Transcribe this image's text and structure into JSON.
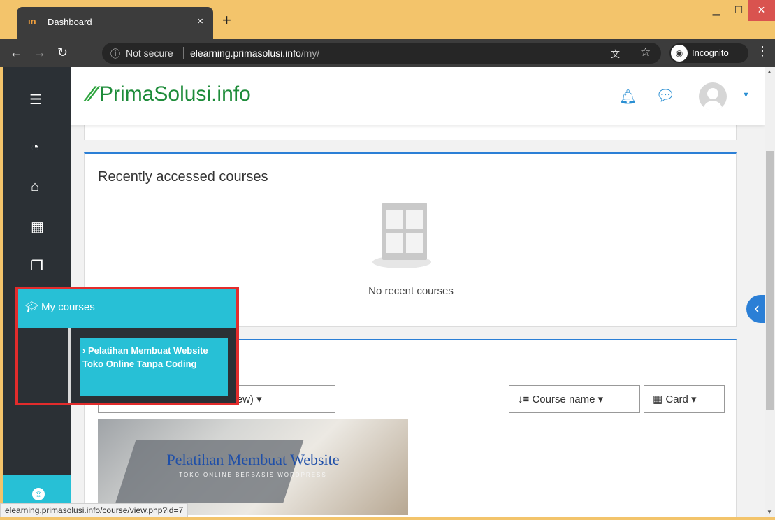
{
  "browser": {
    "tab_title": "Dashboard",
    "favicon_text": "ın",
    "new_tab": "+",
    "tab_close": "×",
    "security_label": "Not secure",
    "url_host": "elearning.primasolusi.info",
    "url_path": "/my/",
    "incognito_label": "Incognito",
    "status_url": "elearning.primasolusi.info/course/view.php?id=7"
  },
  "site": {
    "brand_name": "PrimaSolusi.info",
    "brand_mark": "⁴⁄₄"
  },
  "recent": {
    "title": "Recently accessed courses",
    "empty_text": "No recent courses"
  },
  "overview": {
    "filter_label": "All (except removed from view)",
    "sort_label": "Course name",
    "view_label": "Card",
    "course_image_title": "Pelatihan Membuat Website",
    "course_image_subtitle": "TOKO ONLINE BERBASIS WORDPRESS"
  },
  "my_courses": {
    "header": "My courses",
    "items": [
      {
        "label": "Pelatihan Membuat Website Toko Online Tanpa Coding"
      }
    ]
  },
  "colors": {
    "accent": "#27c0d6",
    "link_blue": "#2b7fd6",
    "brand_green": "#1e8c3a",
    "drawer": "#2b3035",
    "highlight_red": "#e32c2c"
  }
}
